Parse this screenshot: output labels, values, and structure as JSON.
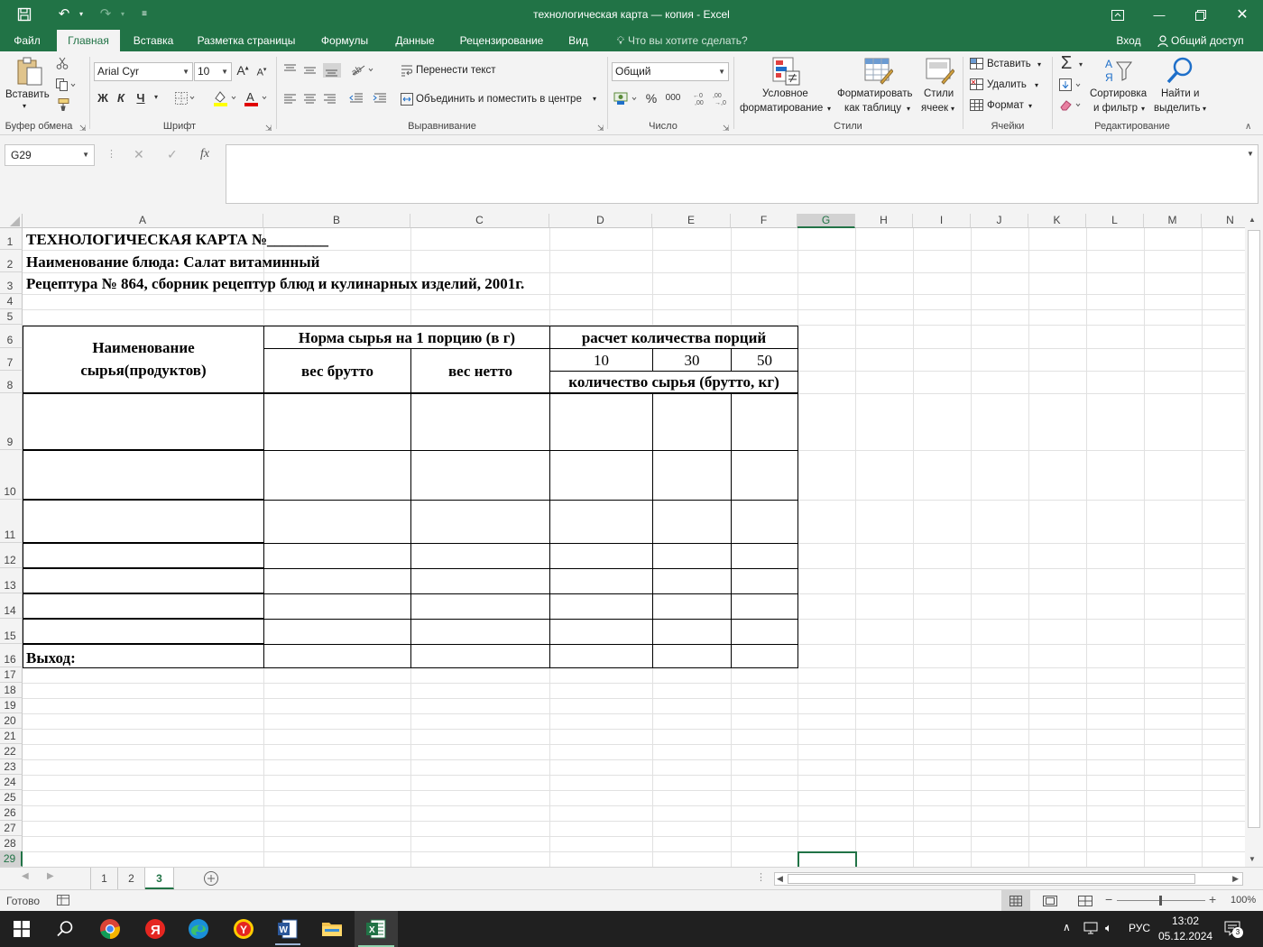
{
  "window": {
    "title": "технологическая карта — копия - Excel"
  },
  "tabs": [
    "Файл",
    "Главная",
    "Вставка",
    "Разметка страницы",
    "Формулы",
    "Данные",
    "Рецензирование",
    "Вид"
  ],
  "tell_me": "Что вы хотите сделать?",
  "signin": "Вход",
  "share": "Общий доступ",
  "ribbon": {
    "clipboard": {
      "paste": "Вставить",
      "label": "Буфер обмена"
    },
    "font": {
      "name": "Arial Cyr",
      "size": "10",
      "bold": "Ж",
      "italic": "К",
      "underline": "Ч",
      "label": "Шрифт"
    },
    "alignment": {
      "wrap": "Перенести текст",
      "merge": "Объединить и поместить в центре",
      "label": "Выравнивание"
    },
    "number": {
      "format": "Общий",
      "percent": "%",
      "thousands": "000",
      "label": "Число"
    },
    "styles": {
      "conditional_1": "Условное",
      "conditional_2": "форматирование",
      "table_1": "Форматировать",
      "table_2": "как таблицу",
      "cell_1": "Стили",
      "cell_2": "ячеек",
      "label": "Стили"
    },
    "cells": {
      "insert": "Вставить",
      "delete": "Удалить",
      "format": "Формат",
      "label": "Ячейки"
    },
    "editing": {
      "sort_1": "Сортировка",
      "sort_2": "и фильтр",
      "find_1": "Найти и",
      "find_2": "выделить",
      "label": "Редактирование"
    }
  },
  "formula_bar": {
    "name_box": "G29",
    "fx": "fx",
    "value": ""
  },
  "columns": [
    "A",
    "B",
    "C",
    "D",
    "E",
    "F",
    "G",
    "H",
    "I",
    "J",
    "K",
    "L",
    "M",
    "N"
  ],
  "rows": [
    "1",
    "2",
    "3",
    "4",
    "5",
    "6",
    "7",
    "8",
    "9",
    "10",
    "11",
    "12",
    "13",
    "14",
    "15",
    "16",
    "17",
    "18",
    "19",
    "20",
    "21",
    "22",
    "23",
    "24",
    "25",
    "26",
    "27",
    "28",
    "29"
  ],
  "sheet": {
    "r1": "ТЕХНОЛОГИЧЕСКАЯ КАРТА №________",
    "r2": "Наименование блюда: Салат витаминный",
    "r3": "Рецептура № 864, сборник рецептур блюд и кулинарных изделий, 2001г.",
    "hdr_name_1": "Наименование",
    "hdr_name_2": "сырья(продуктов)",
    "hdr_norm": "Норма сырья на 1 порцию (в г)",
    "hdr_calc": "расчет количества порций",
    "hdr_brutto": "вес брутто",
    "hdr_netto": "вес нетто",
    "p10": "10",
    "p30": "30",
    "p50": "50",
    "hdr_qty": "количество сырья (брутто, кг)",
    "r16": "Выход:"
  },
  "sheet_tabs": [
    "1",
    "2",
    "3"
  ],
  "active_sheet": "3",
  "status": {
    "ready": "Готово",
    "zoom": "100%"
  },
  "taskbar": {
    "lang": "РУС",
    "time": "13:02",
    "date": "05.12.2024"
  }
}
